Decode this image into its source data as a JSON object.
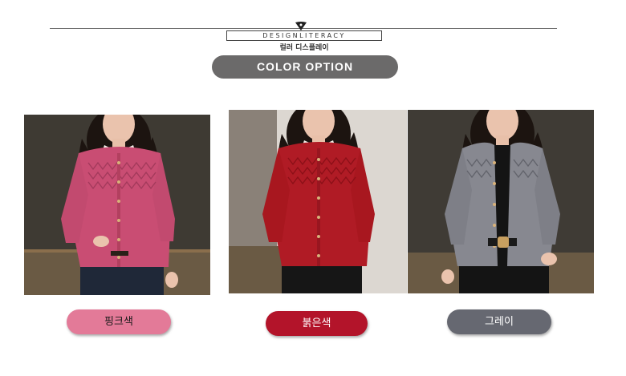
{
  "header": {
    "brand": "DESIGNLITERACY",
    "subtitle": "컬러 디스플레이"
  },
  "color_option_label": "COLOR OPTION",
  "options": [
    {
      "label": "핑크색",
      "color": "#e37a98"
    },
    {
      "label": "붉은색",
      "color": "#b3142a"
    },
    {
      "label": "그레이",
      "color": "#666871"
    }
  ]
}
